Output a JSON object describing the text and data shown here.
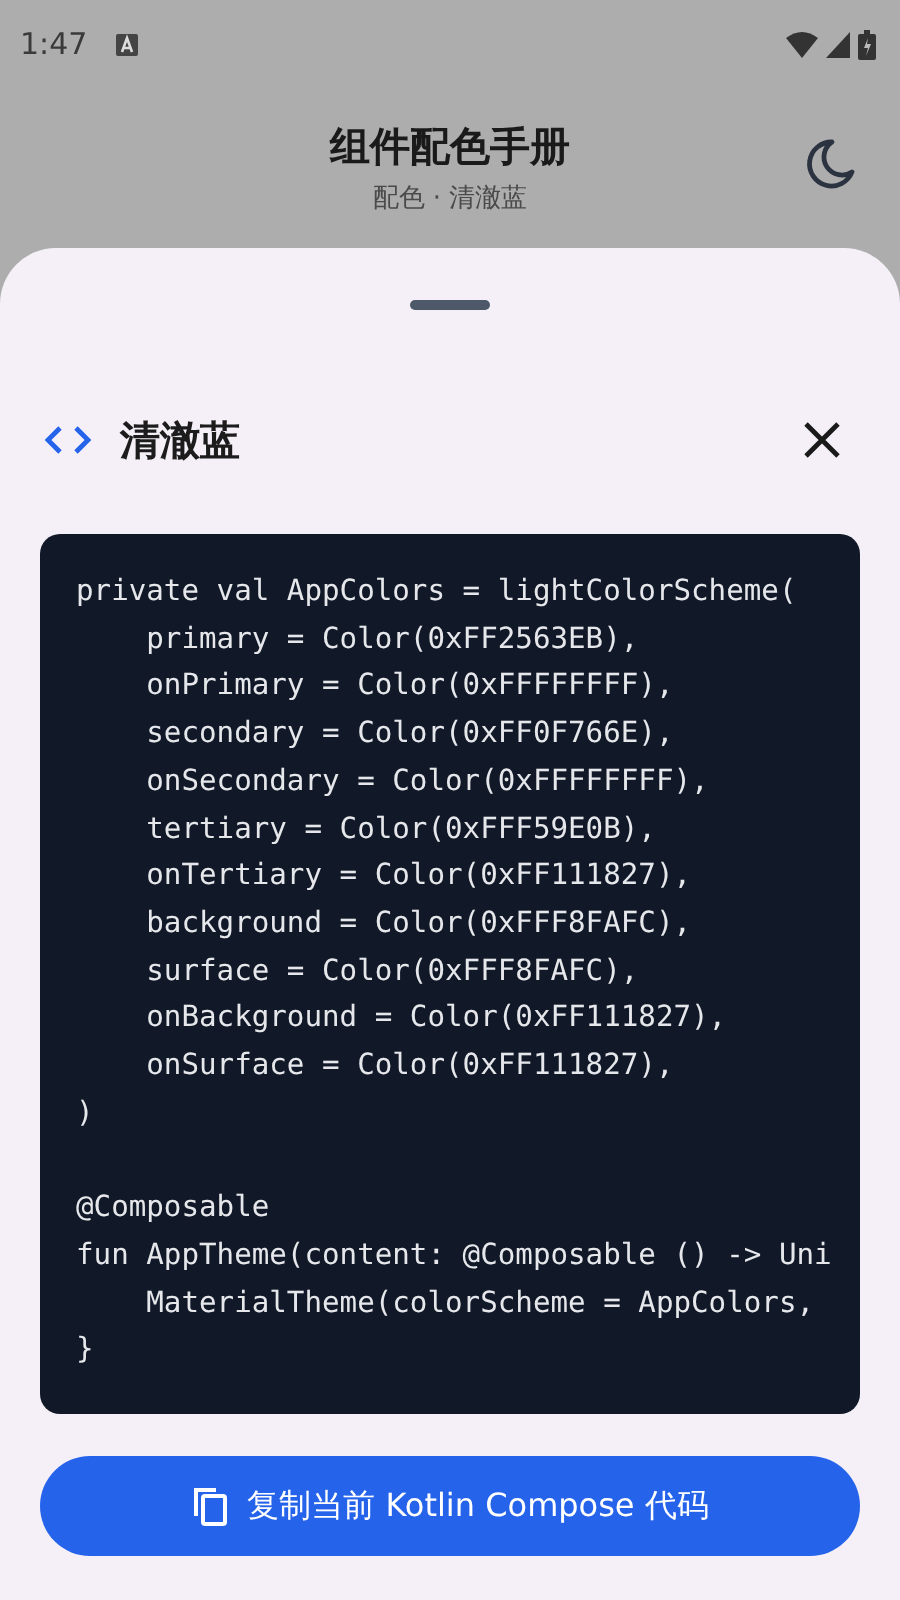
{
  "status_bar": {
    "time": "1:47"
  },
  "header": {
    "title": "组件配色手册",
    "subtitle": "配色 · 清澈蓝"
  },
  "sheet": {
    "title": "清澈蓝",
    "code_blocks": [
      [
        "private val AppColors = lightColorScheme(",
        "    primary = Color(0xFF2563EB),",
        "    onPrimary = Color(0xFFFFFFFF),",
        "    secondary = Color(0xFF0F766E),",
        "    onSecondary = Color(0xFFFFFFFF),",
        "    tertiary = Color(0xFFF59E0B),",
        "    onTertiary = Color(0xFF111827),",
        "    background = Color(0xFFF8FAFC),",
        "    surface = Color(0xFFF8FAFC),",
        "    onBackground = Color(0xFF111827),",
        "    onSurface = Color(0xFF111827),",
        ")"
      ],
      [
        "@Composable",
        "fun AppTheme(content: @Composable () -> Uni",
        "    MaterialTheme(colorScheme = AppColors,",
        "}"
      ]
    ],
    "copy_button": "复制当前 Kotlin Compose 代码"
  }
}
